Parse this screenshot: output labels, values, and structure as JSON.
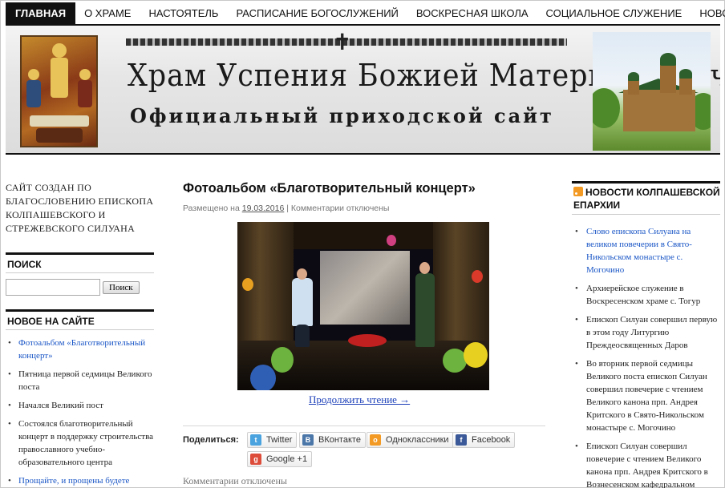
{
  "nav": {
    "items": [
      "ГЛАВНАЯ",
      "О ХРАМЕ",
      "НАСТОЯТЕЛЬ",
      "РАСПИСАНИЕ БОГОСЛУЖЕНИЙ",
      "ВОСКРЕСНАЯ ШКОЛА",
      "СОЦИАЛЬНОЕ СЛУЖЕНИЕ",
      "НОВОСТИ"
    ],
    "active_index": 0
  },
  "banner": {
    "title": "Храм Успения Божией Матери с. Бакчар",
    "subtitle": "Официальный приходской сайт"
  },
  "left": {
    "intro": "САЙТ СОЗДАН ПО БЛАГОСЛОВЕНИЮ ЕПИСКОПА КОЛПАШЕВСКОГО И СТРЕЖЕВСКОГО СИЛУАНА",
    "search_title": "ПОИСК",
    "search_value": "",
    "search_button": "Поиск",
    "recent_title": "НОВОЕ НА САЙТЕ",
    "recent": [
      {
        "text": "Фотоальбом «Благотворительный концерт»",
        "link": true
      },
      {
        "text": "Пятница первой седмицы Великого поста",
        "link": false
      },
      {
        "text": "Начался Великий пост",
        "link": false
      },
      {
        "text": "Состоялся благотворительный концерт в поддержку строительства православного учебно-образовательного центра",
        "link": false
      },
      {
        "text": "Прощайте, и прощены будете",
        "link": true
      }
    ]
  },
  "main": {
    "title": "Фотоальбом «Благотворительный концерт»",
    "meta_prefix": "Размещено на",
    "meta_date": "19.03.2016",
    "meta_sep": "|",
    "meta_comments": "Комментарии отключены",
    "read_more": "Продолжить чтение →",
    "share_label": "Поделиться:",
    "share": [
      {
        "label": "Twitter",
        "icon": "twitter-icon",
        "color": "#4aa3df"
      },
      {
        "label": "ВКонтакте",
        "icon": "vk-icon",
        "color": "#4a76a8"
      },
      {
        "label": "Одноклассники",
        "icon": "ok-icon",
        "color": "#f39a24"
      },
      {
        "label": "Facebook",
        "icon": "facebook-icon",
        "color": "#3b5998"
      },
      {
        "label": "Google +1",
        "icon": "google-plus-icon",
        "color": "#dd4b39"
      }
    ],
    "comments_closed": "Комментарии отключены"
  },
  "right": {
    "title": "НОВОСТИ КОЛПАШЕВСКОЙ ЕПАРХИИ",
    "news": [
      {
        "text": "Слово епископа Силуана на великом повечерии в Свято-Никольском монастыре с. Могочино",
        "link": true
      },
      {
        "text": "Архиерейское служение в Воскресенском храме с. Тогур",
        "link": false
      },
      {
        "text": "Епископ Силуан совершил первую в этом году Литургию Преждеосвященных Даров",
        "link": false
      },
      {
        "text": "Во вторник первой седмицы Великого поста епископ Силуан совершил повечерие с чтением Великого канона прп. Андрея Критского в Свято-Никольском монастыре с. Могочино",
        "link": false
      },
      {
        "text": "Епископ Силуан совершил повечерие с чтением Великого канона прп. Андрея Критского в Вознесенском кафедральном",
        "link": false
      }
    ]
  }
}
